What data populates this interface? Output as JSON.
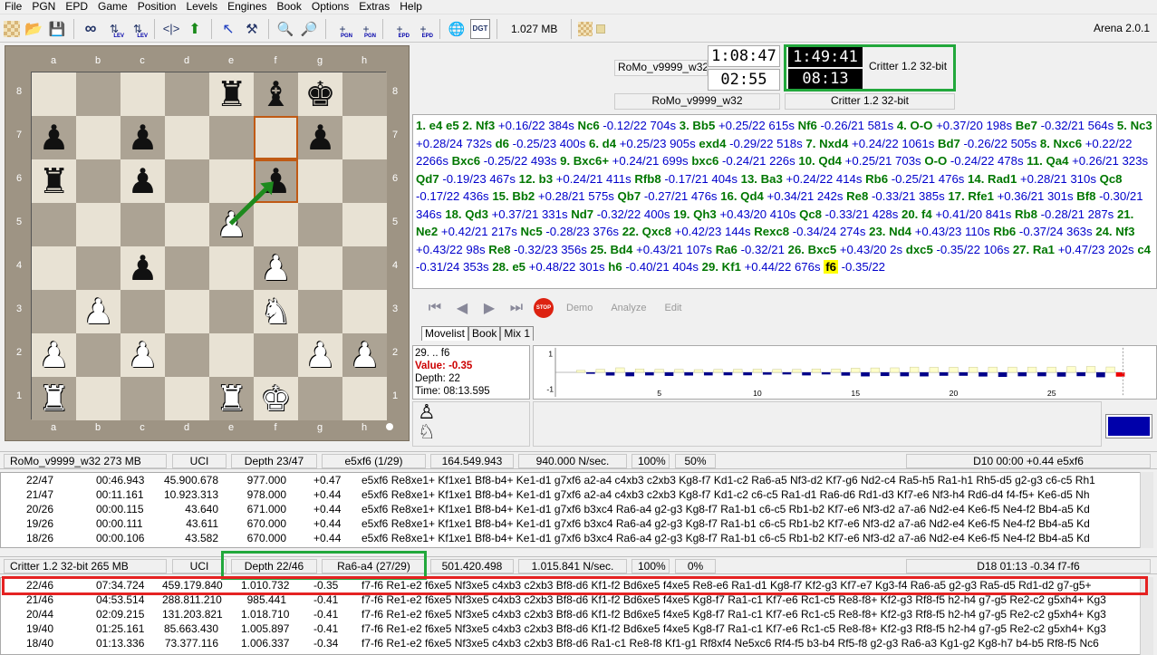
{
  "menu": [
    "File",
    "PGN",
    "EPD",
    "Game",
    "Position",
    "Levels",
    "Engines",
    "Book",
    "Options",
    "Extras",
    "Help"
  ],
  "toolbar": {
    "memory": "1.027 MB",
    "app_version": "Arena 2.0.1",
    "sub_labels": {
      "lev": "LEV",
      "pgn": "PGN",
      "epd": "EPD",
      "dgt": "DGT"
    }
  },
  "board": {
    "files": [
      "a",
      "b",
      "c",
      "d",
      "e",
      "f",
      "g",
      "h"
    ],
    "ranks": [
      "8",
      "7",
      "6",
      "5",
      "4",
      "3",
      "2",
      "1"
    ],
    "pieces": {
      "e8": "♜b",
      "f8": "♝b",
      "g8": "♚b",
      "a7": "♟b",
      "c7": "♟b",
      "g7": "♟b",
      "a6": "♜b",
      "c6": "♟b",
      "f6": "♟b",
      "e5": "♙w",
      "c4": "♟b",
      "f4": "♙w",
      "b3": "♙w",
      "f3": "♘w",
      "a2": "♙w",
      "c2": "♙w",
      "g2": "♙w",
      "h2": "♙w",
      "a1": "♖w",
      "e1": "♖w",
      "f1": "♔w"
    },
    "highlight": [
      "f7",
      "f6"
    ],
    "last_move_arrow": {
      "from": "e5",
      "to": "f6",
      "color": "#1e8a1e"
    }
  },
  "clock": {
    "white_player_top": "RoMo_v9999_w32",
    "white_time_total": "1:08:47",
    "white_time_move": "02:55",
    "black_time_total": "1:49:41",
    "black_time_move": "08:13",
    "black_player_top": "Critter 1.2 32-bit",
    "white_player_bottom": "RoMo_v9999_w32",
    "black_player_bottom": "Critter 1.2 32-bit"
  },
  "movelist": [
    [
      "m",
      "1. e4 e5 2. Nf3"
    ],
    [
      "e",
      " +0.16/22 384s "
    ],
    [
      "m",
      "Nc6"
    ],
    [
      "e",
      " -0.12/22 704s "
    ],
    [
      "m",
      "3. Bb5"
    ],
    [
      "e",
      " +0.25/22 615s "
    ],
    [
      "m",
      "Nf6"
    ],
    [
      "e",
      " -0.26/21 581s "
    ],
    [
      "m",
      "4. O-O"
    ],
    [
      "e",
      " +0.37/20 198s "
    ],
    [
      "m",
      "Be7"
    ],
    [
      "e",
      " -0.32/21 564s "
    ],
    [
      "m",
      "5. Nc3"
    ],
    [
      "e",
      " +0.28/24 732s "
    ],
    [
      "m",
      "d6"
    ],
    [
      "e",
      " -0.25/23 400s "
    ],
    [
      "m",
      "6. d4"
    ],
    [
      "e",
      " +0.25/23 905s "
    ],
    [
      "m",
      "exd4"
    ],
    [
      "e",
      " -0.29/22 518s "
    ],
    [
      "m",
      "7. Nxd4"
    ],
    [
      "e",
      " +0.24/22 1061s "
    ],
    [
      "m",
      "Bd7"
    ],
    [
      "e",
      " -0.26/22 505s "
    ],
    [
      "m",
      "8. Nxc6"
    ],
    [
      "e",
      " +0.22/22 2266s "
    ],
    [
      "m",
      "Bxc6"
    ],
    [
      "e",
      " -0.25/22 493s "
    ],
    [
      "m",
      "9. Bxc6+"
    ],
    [
      "e",
      " +0.24/21 699s "
    ],
    [
      "m",
      "bxc6"
    ],
    [
      "e",
      " -0.24/21 226s "
    ],
    [
      "m",
      "10. Qd4"
    ],
    [
      "e",
      " +0.25/21 703s "
    ],
    [
      "m",
      "O-O"
    ],
    [
      "e",
      " -0.24/22 478s "
    ],
    [
      "m",
      "11. Qa4"
    ],
    [
      "e",
      " +0.26/21 323s "
    ],
    [
      "m",
      "Qd7"
    ],
    [
      "e",
      " -0.19/23 467s "
    ],
    [
      "m",
      "12. b3"
    ],
    [
      "e",
      " +0.24/21 411s "
    ],
    [
      "m",
      "Rfb8"
    ],
    [
      "e",
      " -0.17/21 404s "
    ],
    [
      "m",
      "13. Ba3"
    ],
    [
      "e",
      " +0.24/22 414s "
    ],
    [
      "m",
      "Rb6"
    ],
    [
      "e",
      " -0.25/21 476s "
    ],
    [
      "m",
      "14. Rad1"
    ],
    [
      "e",
      " +0.28/21 310s "
    ],
    [
      "m",
      "Qc8"
    ],
    [
      "e",
      " -0.17/22 436s "
    ],
    [
      "m",
      "15. Bb2"
    ],
    [
      "e",
      " +0.28/21 575s "
    ],
    [
      "m",
      "Qb7"
    ],
    [
      "e",
      " -0.27/21 476s "
    ],
    [
      "m",
      "16. Qd4"
    ],
    [
      "e",
      " +0.34/21 242s "
    ],
    [
      "m",
      "Re8"
    ],
    [
      "e",
      " -0.33/21 385s "
    ],
    [
      "m",
      "17. Rfe1"
    ],
    [
      "e",
      " +0.36/21 301s "
    ],
    [
      "m",
      "Bf8"
    ],
    [
      "e",
      " -0.30/21 346s "
    ],
    [
      "m",
      "18. Qd3"
    ],
    [
      "e",
      " +0.37/21 "
    ],
    [
      "e",
      "331s "
    ],
    [
      "m",
      "Nd7"
    ],
    [
      "e",
      " -0.32/22 400s "
    ],
    [
      "m",
      "19. Qh3"
    ],
    [
      "e",
      " +0.43/20 410s "
    ],
    [
      "m",
      "Qc8"
    ],
    [
      "e",
      " -0.33/21 428s "
    ],
    [
      "m",
      "20. f4"
    ],
    [
      "e",
      " +0.41/20 841s "
    ],
    [
      "m",
      "Rb8"
    ],
    [
      "e",
      " -0.28/21 287s "
    ],
    [
      "m",
      "21. Ne2"
    ],
    [
      "e",
      " +0.42/21 217s "
    ],
    [
      "m",
      "Nc5"
    ],
    [
      "e",
      " -0.28/23 376s "
    ],
    [
      "m",
      "22. Qxc8"
    ],
    [
      "e",
      " +0.42/23 144s "
    ],
    [
      "m",
      "Rexc8"
    ],
    [
      "e",
      " -0.34/24 274s "
    ],
    [
      "m",
      "23. Nd4"
    ],
    [
      "e",
      " +0.43/23 110s "
    ],
    [
      "m",
      "Rb6"
    ],
    [
      "e",
      " -0.37/24 "
    ],
    [
      "e",
      "363s "
    ],
    [
      "m",
      "24. Nf3"
    ],
    [
      "e",
      " +0.43/22 98s "
    ],
    [
      "m",
      "Re8"
    ],
    [
      "e",
      " -0.32/23 356s "
    ],
    [
      "m",
      "25. Bd4"
    ],
    [
      "e",
      " +0.43/21 107s "
    ],
    [
      "m",
      "Ra6"
    ],
    [
      "e",
      " -0.32/21 "
    ],
    [
      "m",
      "26. Bxc5"
    ],
    [
      "e",
      " +0.43/20 2s "
    ],
    [
      "m",
      "dxc5"
    ],
    [
      "e",
      " -0.35/22 "
    ],
    [
      "e",
      "106s "
    ],
    [
      "m",
      "27. Ra1"
    ],
    [
      "e",
      " +0.47/23 202s "
    ],
    [
      "m",
      "c4"
    ],
    [
      "e",
      " -0.31/24 353s "
    ],
    [
      "m",
      "28. e5"
    ],
    [
      "e",
      " +0.48/22 301s "
    ],
    [
      "m",
      "h6"
    ],
    [
      "e",
      " -0.40/21 404s "
    ],
    [
      "m",
      "29. Kf1"
    ],
    [
      "e",
      " +0.44/22 676s "
    ],
    [
      "c",
      "f6"
    ],
    [
      "e",
      " -0.35/22"
    ]
  ],
  "nav": {
    "stop": "STOP",
    "demo": "Demo",
    "analyze": "Analyze",
    "edit": "Edit"
  },
  "tabs": [
    "Movelist",
    "Book",
    "Mix 1"
  ],
  "info": {
    "move": "29. .. f6",
    "value": "Value: -0.35",
    "depth": "Depth: 22",
    "time": "Time: 08:13.595"
  },
  "graph": {
    "y_top": "1",
    "y_bottom": "-1",
    "x_ticks": [
      "5",
      "10",
      "15",
      "20",
      "25"
    ],
    "evals": [
      0.16,
      -0.12,
      0.25,
      -0.26,
      0.37,
      -0.32,
      0.28,
      -0.25,
      0.25,
      -0.29,
      0.24,
      -0.26,
      0.22,
      -0.25,
      0.24,
      -0.24,
      0.25,
      -0.24,
      0.26,
      -0.19,
      0.24,
      -0.17,
      0.24,
      -0.25,
      0.28,
      -0.17,
      0.28,
      -0.27,
      0.34,
      -0.33,
      0.36,
      -0.3,
      0.37,
      -0.32,
      0.43,
      -0.33,
      0.41,
      -0.28,
      0.42,
      -0.28,
      0.42,
      -0.34,
      0.43,
      -0.37,
      0.43,
      -0.32,
      0.43,
      -0.32,
      0.43,
      -0.35,
      0.47,
      -0.31,
      0.48,
      -0.4,
      0.44,
      -0.35
    ]
  },
  "engine1": {
    "header": [
      "RoMo_v9999_w32  273 MB",
      "UCI",
      "Depth 23/47",
      "e5xf6 (1/29)",
      "164.549.943",
      "940.000 N/sec.",
      "100%",
      "50%",
      "D10  00:00  +0.44   e5xf6"
    ],
    "rows": [
      [
        "22/47",
        "00:46.943",
        "45.900.678",
        "977.000",
        "+0.47",
        "e5xf6 Re8xe1+ Kf1xe1 Bf8-b4+ Ke1-d1 g7xf6 a2-a4 c4xb3 c2xb3 Kg8-f7 Kd1-c2 Ra6-a5 Nf3-d2 Kf7-g6 Nd2-c4 Ra5-h5 Ra1-h1 Rh5-d5 g2-g3 c6-c5 Rh1"
      ],
      [
        "21/47",
        "00:11.161",
        "10.923.313",
        "978.000",
        "+0.44",
        "e5xf6 Re8xe1+ Kf1xe1 Bf8-b4+ Ke1-d1 g7xf6 a2-a4 c4xb3 c2xb3 Kg8-f7 Kd1-c2 c6-c5 Ra1-d1 Ra6-d6 Rd1-d3 Kf7-e6 Nf3-h4 Rd6-d4 f4-f5+ Ke6-d5 Nh"
      ],
      [
        "20/26",
        "00:00.115",
        "43.640",
        "671.000",
        "+0.44",
        "e5xf6 Re8xe1+ Kf1xe1 Bf8-b4+ Ke1-d1 g7xf6 b3xc4 Ra6-a4 g2-g3 Kg8-f7 Ra1-b1 c6-c5 Rb1-b2 Kf7-e6 Nf3-d2 a7-a6 Nd2-e4 Ke6-f5 Ne4-f2 Bb4-a5 Kd"
      ],
      [
        "19/26",
        "00:00.111",
        "43.611",
        "670.000",
        "+0.44",
        "e5xf6 Re8xe1+ Kf1xe1 Bf8-b4+ Ke1-d1 g7xf6 b3xc4 Ra6-a4 g2-g3 Kg8-f7 Ra1-b1 c6-c5 Rb1-b2 Kf7-e6 Nf3-d2 a7-a6 Nd2-e4 Ke6-f5 Ne4-f2 Bb4-a5 Kd"
      ],
      [
        "18/26",
        "00:00.106",
        "43.582",
        "670.000",
        "+0.44",
        "e5xf6 Re8xe1+ Kf1xe1 Bf8-b4+ Ke1-d1 g7xf6 b3xc4 Ra6-a4 g2-g3 Kg8-f7 Ra1-b1 c6-c5 Rb1-b2 Kf7-e6 Nf3-d2 a7-a6 Nd2-e4 Ke6-f5 Ne4-f2 Bb4-a5 Kd"
      ]
    ]
  },
  "engine2": {
    "header": [
      "Critter 1.2 32-bit  265 MB",
      "UCI",
      "Depth 22/46",
      "Ra6-a4 (27/29)",
      "501.420.498",
      "1.015.841 N/sec.",
      "100%",
      "0%",
      "D18  01:13  -0.34   f7-f6"
    ],
    "rows": [
      [
        "22/46",
        "07:34.724",
        "459.179.840",
        "1.010.732",
        "-0.35",
        "f7-f6 Re1-e2 f6xe5 Nf3xe5 c4xb3 c2xb3 Bf8-d6 Kf1-f2 Bd6xe5 f4xe5 Re8-e6 Ra1-d1 Kg8-f7 Kf2-g3 Kf7-e7 Kg3-f4 Ra6-a5 g2-g3 Ra5-d5 Rd1-d2 g7-g5+"
      ],
      [
        "21/46",
        "04:53.514",
        "288.811.210",
        "985.441",
        "-0.41",
        "f7-f6 Re1-e2 f6xe5 Nf3xe5 c4xb3 c2xb3 Bf8-d6 Kf1-f2 Bd6xe5 f4xe5 Kg8-f7 Ra1-c1 Kf7-e6 Rc1-c5 Re8-f8+ Kf2-g3 Rf8-f5 h2-h4 g7-g5 Re2-c2 g5xh4+ Kg3"
      ],
      [
        "20/44",
        "02:09.215",
        "131.203.821",
        "1.018.710",
        "-0.41",
        "f7-f6 Re1-e2 f6xe5 Nf3xe5 c4xb3 c2xb3 Bf8-d6 Kf1-f2 Bd6xe5 f4xe5 Kg8-f7 Ra1-c1 Kf7-e6 Rc1-c5 Re8-f8+ Kf2-g3 Rf8-f5 h2-h4 g7-g5 Re2-c2 g5xh4+ Kg3"
      ],
      [
        "19/40",
        "01:25.161",
        "85.663.430",
        "1.005.897",
        "-0.41",
        "f7-f6 Re1-e2 f6xe5 Nf3xe5 c4xb3 c2xb3 Bf8-d6 Kf1-f2 Bd6xe5 f4xe5 Kg8-f7 Ra1-c1 Kf7-e6 Rc1-c5 Re8-f8+ Kf2-g3 Rf8-f5 h2-h4 g7-g5 Re2-c2 g5xh4+ Kg3"
      ],
      [
        "18/40",
        "01:13.336",
        "73.377.116",
        "1.006.337",
        "-0.34",
        "f7-f6 Re1-e2 f6xe5 Nf3xe5 c4xb3 c2xb3 Bf8-d6 Ra1-c1 Re8-f8 Kf1-g1 Rf8xf4 Ne5xc6 Rf4-f5 b3-b4 Rf5-f8 g2-g3 Ra6-a3 Kg1-g2 Kg8-h7 b4-b5 Rf8-f5 Nc6"
      ]
    ]
  }
}
